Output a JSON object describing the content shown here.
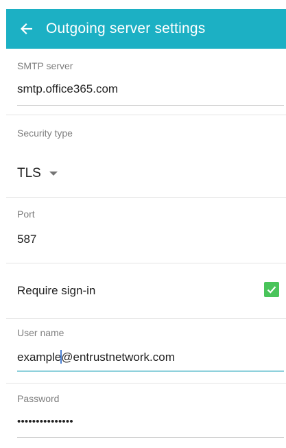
{
  "appbar": {
    "title": "Outgoing server settings",
    "back_icon": "arrow-back-icon",
    "color": "#1cb0c4"
  },
  "smtp": {
    "label": "SMTP server",
    "value": "smtp.office365.com"
  },
  "security": {
    "label": "Security type",
    "value": "TLS",
    "icon": "dropdown-caret-icon"
  },
  "port": {
    "label": "Port",
    "value": "587"
  },
  "signin": {
    "label": "Require sign-in",
    "checked": true,
    "check_color": "#49c45a"
  },
  "username": {
    "label": "User name",
    "value_before_cursor": "example",
    "value_after_cursor": "@entrustnetwork.com"
  },
  "password": {
    "label": "Password",
    "value": "•••••••••••••••"
  }
}
